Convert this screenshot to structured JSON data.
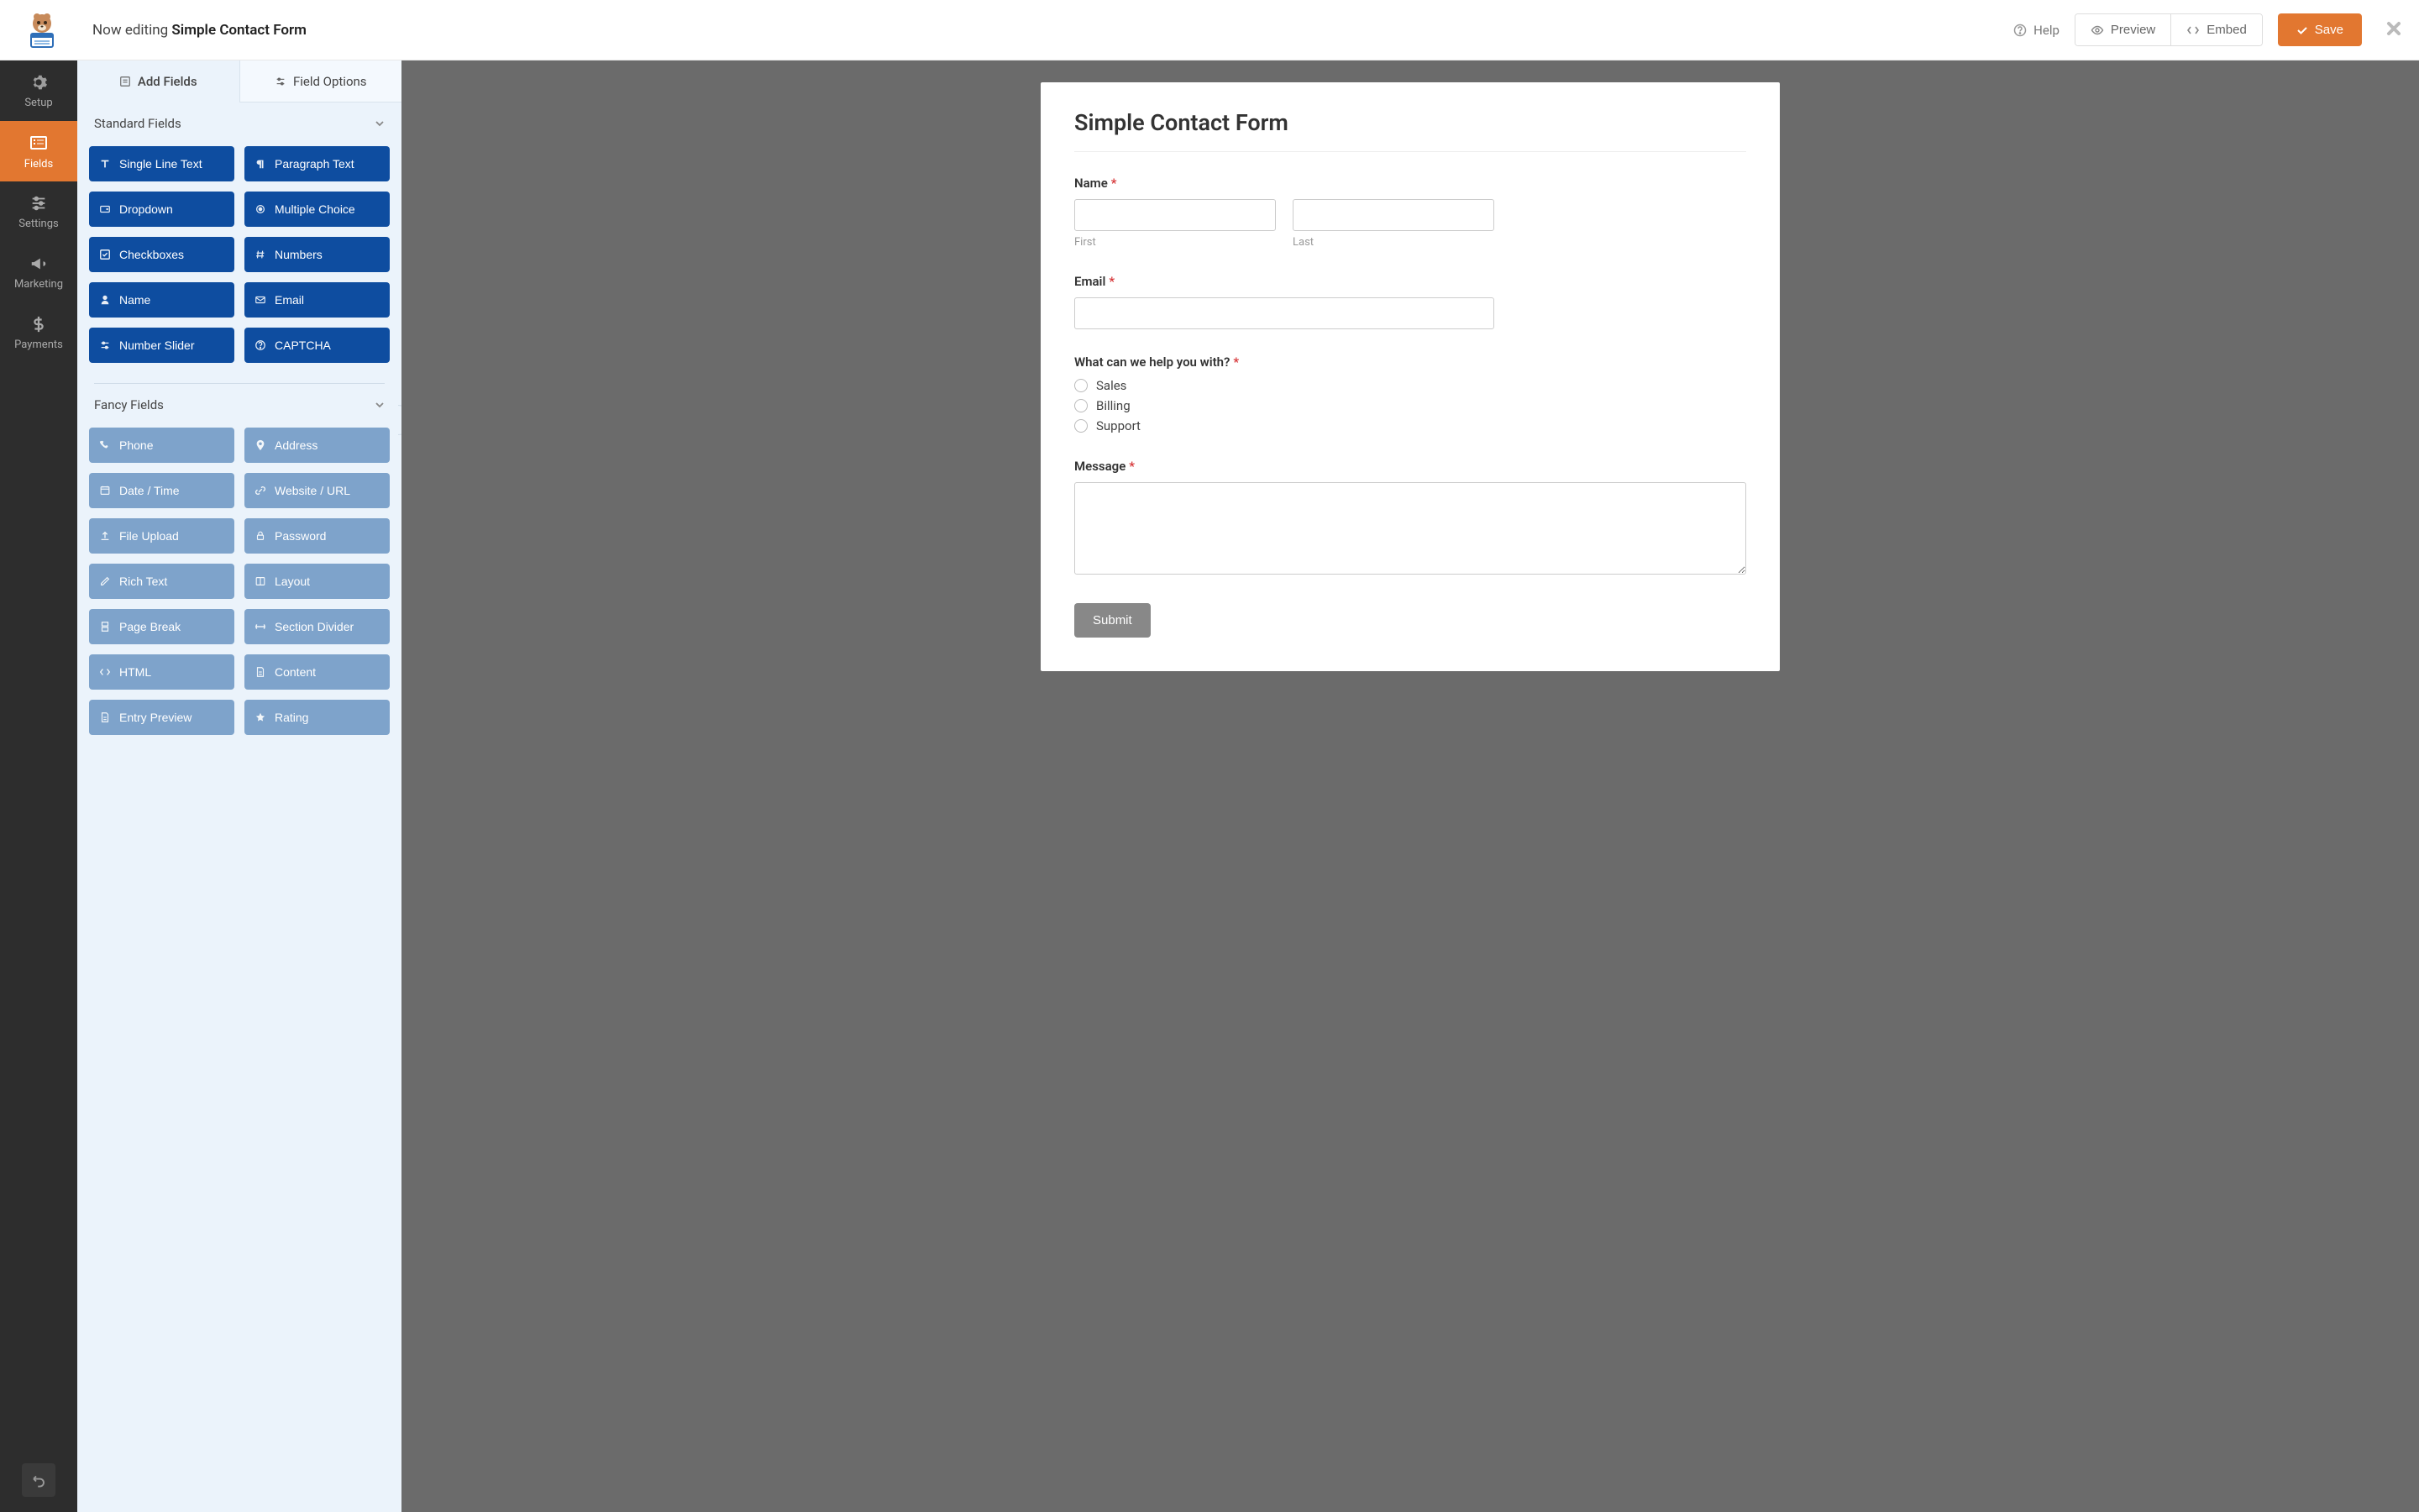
{
  "topbar": {
    "editing_prefix": "Now editing ",
    "form_name": "Simple Contact Form",
    "help": "Help",
    "preview": "Preview",
    "embed": "Embed",
    "save": "Save"
  },
  "leftnav": {
    "items": [
      {
        "label": "Setup",
        "icon": "gear"
      },
      {
        "label": "Fields",
        "icon": "list"
      },
      {
        "label": "Settings",
        "icon": "sliders"
      },
      {
        "label": "Marketing",
        "icon": "bullhorn"
      },
      {
        "label": "Payments",
        "icon": "dollar"
      }
    ]
  },
  "panel": {
    "tab_add": "Add Fields",
    "tab_options": "Field Options",
    "sections": {
      "standard": {
        "title": "Standard Fields",
        "items": [
          {
            "label": "Single Line Text",
            "icon": "text"
          },
          {
            "label": "Paragraph Text",
            "icon": "paragraph"
          },
          {
            "label": "Dropdown",
            "icon": "dropdown"
          },
          {
            "label": "Multiple Choice",
            "icon": "radio"
          },
          {
            "label": "Checkboxes",
            "icon": "check"
          },
          {
            "label": "Numbers",
            "icon": "hash"
          },
          {
            "label": "Name",
            "icon": "user"
          },
          {
            "label": "Email",
            "icon": "mail"
          },
          {
            "label": "Number Slider",
            "icon": "sliders"
          },
          {
            "label": "CAPTCHA",
            "icon": "question"
          }
        ]
      },
      "fancy": {
        "title": "Fancy Fields",
        "items": [
          {
            "label": "Phone",
            "icon": "phone"
          },
          {
            "label": "Address",
            "icon": "pin"
          },
          {
            "label": "Date / Time",
            "icon": "calendar"
          },
          {
            "label": "Website / URL",
            "icon": "link"
          },
          {
            "label": "File Upload",
            "icon": "upload"
          },
          {
            "label": "Password",
            "icon": "lock"
          },
          {
            "label": "Rich Text",
            "icon": "edit"
          },
          {
            "label": "Layout",
            "icon": "columns"
          },
          {
            "label": "Page Break",
            "icon": "pagebreak"
          },
          {
            "label": "Section Divider",
            "icon": "divider"
          },
          {
            "label": "HTML",
            "icon": "code"
          },
          {
            "label": "Content",
            "icon": "file"
          },
          {
            "label": "Entry Preview",
            "icon": "file"
          },
          {
            "label": "Rating",
            "icon": "star"
          }
        ]
      }
    }
  },
  "form": {
    "title": "Simple Contact Form",
    "name_label": "Name",
    "first_sublabel": "First",
    "last_sublabel": "Last",
    "email_label": "Email",
    "choice_label": "What can we help you with?",
    "choice_options": [
      "Sales",
      "Billing",
      "Support"
    ],
    "message_label": "Message",
    "submit": "Submit"
  }
}
